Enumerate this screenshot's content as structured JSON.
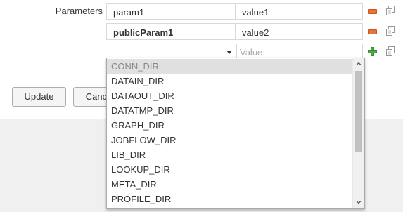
{
  "parameters": {
    "label": "Parameters",
    "rows": [
      {
        "name": "param1",
        "value": "value1"
      },
      {
        "name": "publicParam1",
        "value": "value2"
      }
    ],
    "new_row": {
      "name_value": "",
      "value_placeholder": "Value"
    }
  },
  "buttons": {
    "update": "Update",
    "cancel": "Cancel"
  },
  "dropdown": {
    "options": [
      "CONN_DIR",
      "DATAIN_DIR",
      "DATAOUT_DIR",
      "DATATMP_DIR",
      "GRAPH_DIR",
      "JOBFLOW_DIR",
      "LIB_DIR",
      "LOOKUP_DIR",
      "META_DIR",
      "PROFILE_DIR"
    ],
    "highlighted_index": 0
  },
  "icons": {
    "remove": "minus-icon",
    "copy": "copy-icon",
    "add": "plus-icon",
    "combo_arrow": "chevron-down-icon",
    "scroll_up": "chevron-up-icon",
    "scroll_down": "chevron-down-icon"
  },
  "colors": {
    "remove_icon": "#e8743b",
    "add_icon": "#4ca943",
    "highlight_bg": "#e0e0e0",
    "panel_bg": "#f0f0f0"
  }
}
